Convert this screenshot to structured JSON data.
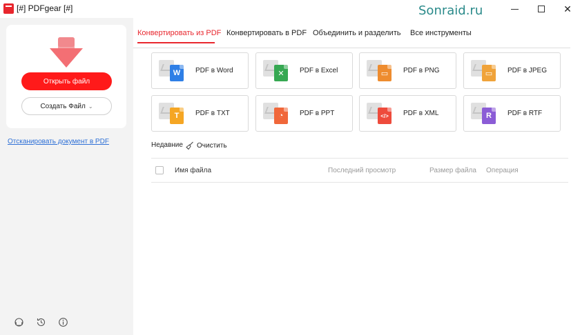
{
  "window": {
    "title": "[#] PDFgear [#]",
    "watermark": "Sonraid.ru",
    "controls": {
      "minimize": "minimize",
      "maximize": "maximize",
      "close": "✕"
    }
  },
  "sidebar": {
    "open_button": "Открыть файл",
    "create_button": "Создать Файл",
    "scan_link": "Отсканировать документ в PDF",
    "bottom_icons": [
      "support-icon",
      "history-icon",
      "info-icon"
    ]
  },
  "tabs": [
    {
      "label": "Конвертировать из PDF",
      "active": true
    },
    {
      "label": "Конвертировать в PDF",
      "active": false
    },
    {
      "label": "Объединить и разделить",
      "active": false
    },
    {
      "label": "Все инструменты",
      "active": false
    }
  ],
  "tools": [
    {
      "label": "PDF в Word",
      "icon": "word-icon",
      "color": "#2f7fe6",
      "glyph": "W"
    },
    {
      "label": "PDF в Excel",
      "icon": "excel-icon",
      "color": "#36a852",
      "glyph": "✕"
    },
    {
      "label": "PDF в PNG",
      "icon": "png-icon",
      "color": "#ee8c2f",
      "glyph": "▭"
    },
    {
      "label": "PDF в JPEG",
      "icon": "jpeg-icon",
      "color": "#f0a33a",
      "glyph": "▭"
    },
    {
      "label": "PDF в TXT",
      "icon": "txt-icon",
      "color": "#f5a623",
      "glyph": "T"
    },
    {
      "label": "PDF в PPT",
      "icon": "ppt-icon",
      "color": "#f0673a",
      "glyph": "◔"
    },
    {
      "label": "PDF в XML",
      "icon": "xml-icon",
      "color": "#ee4b3c",
      "glyph": "</>"
    },
    {
      "label": "PDF в RTF",
      "icon": "rtf-icon",
      "color": "#8b5cd6",
      "glyph": "R"
    }
  ],
  "recent": {
    "label": "Недавние",
    "clear": "Очистить",
    "columns": {
      "name": "Имя файла",
      "last_viewed": "Последний просмотр",
      "size": "Размер файла",
      "operation": "Операция"
    }
  }
}
